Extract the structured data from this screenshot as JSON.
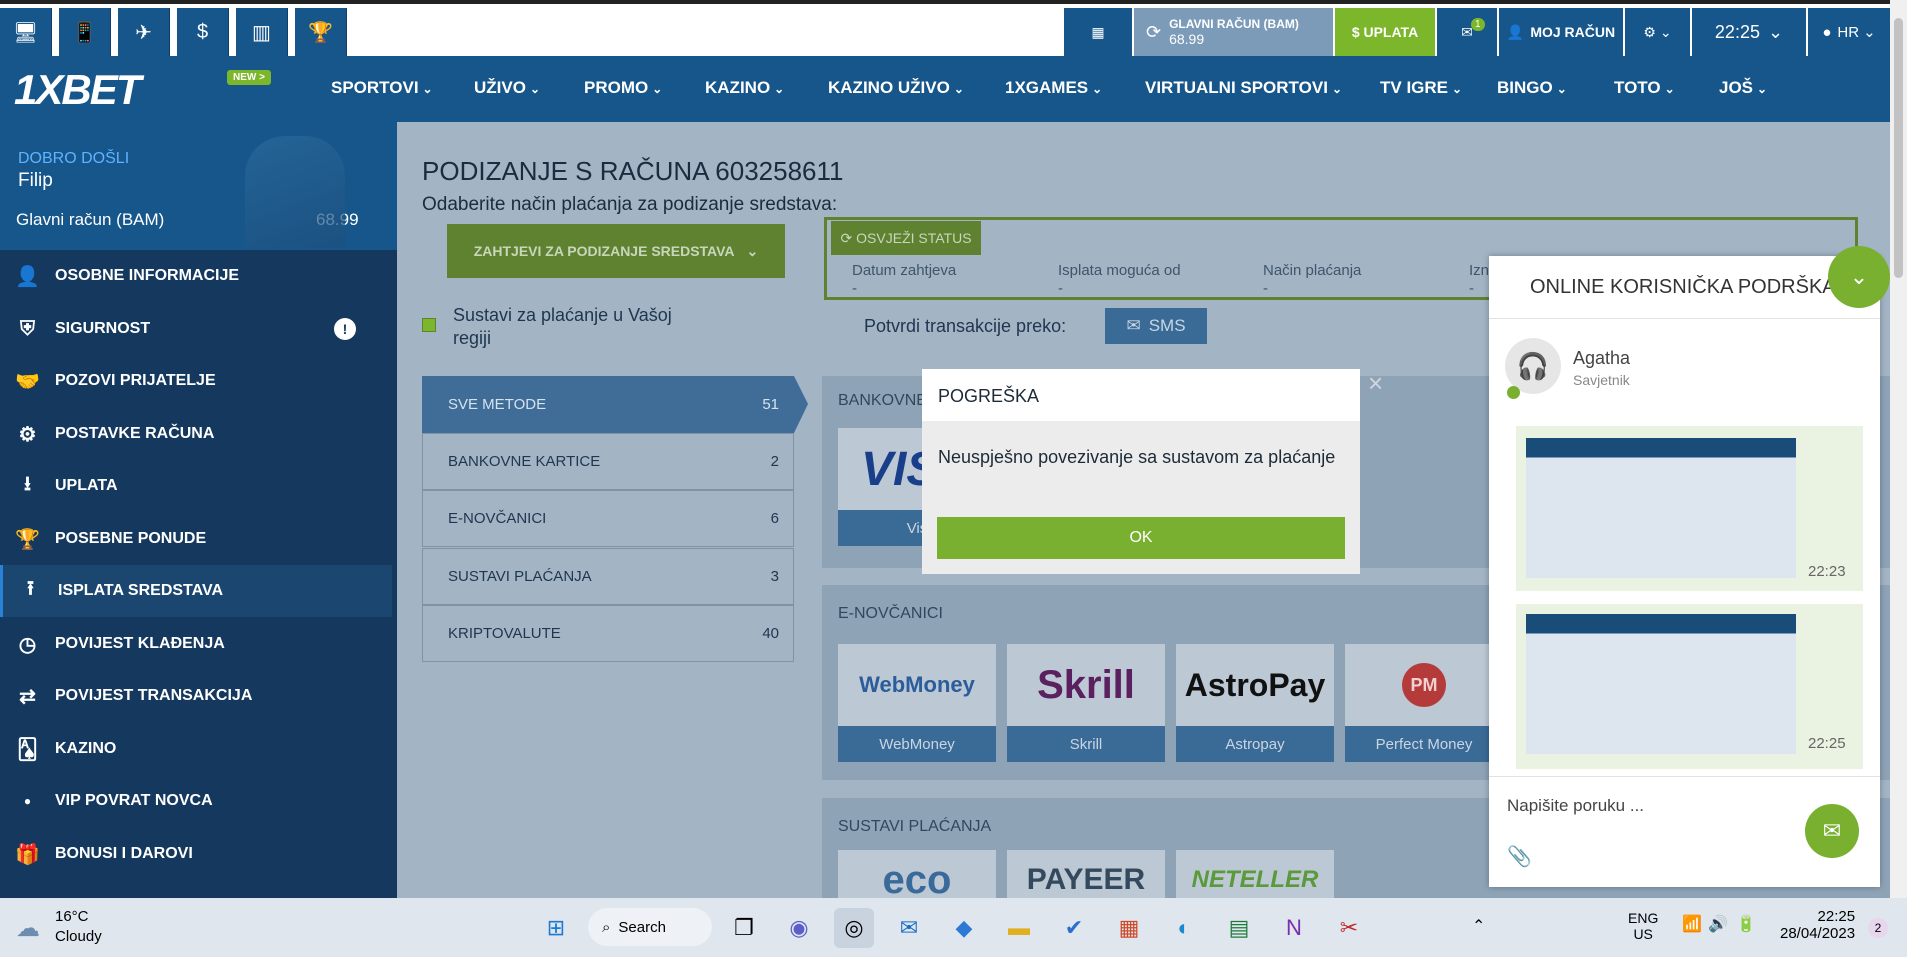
{
  "topbar": {
    "icons": [
      "desktop-icon",
      "mobile-icon",
      "telegram-icon",
      "dollar-icon",
      "stats-icon",
      "trophy-icon"
    ],
    "balance_label": "GLAVNI RAČUN (BAM)",
    "balance_value": "68.99",
    "deposit_label": "$ UPLATA",
    "messages_count": "1",
    "account_label": "MOJ RAČUN",
    "time": "22:25",
    "lang": "HR"
  },
  "nav": {
    "logo": "1XBET",
    "new_badge": "NEW >",
    "items": [
      "SPORTOVI",
      "UŽIVO",
      "PROMO",
      "KAZINO",
      "KAZINO UŽIVO",
      "1XGAMES",
      "VIRTUALNI SPORTOVI",
      "TV IGRE",
      "BINGO",
      "TOTO",
      "JOŠ"
    ]
  },
  "sidebar": {
    "welcome": "DOBRO DOŠLI",
    "user": "Filip",
    "account_label": "Glavni račun (BAM)",
    "account_value": "68.99",
    "items": [
      {
        "label": "OSOBNE INFORMACIJE",
        "icon": "user-add-icon"
      },
      {
        "label": "SIGURNOST",
        "icon": "shield-icon"
      },
      {
        "label": "POZOVI PRIJATELJE",
        "icon": "handshake-icon"
      },
      {
        "label": "POSTAVKE RAČUNA",
        "icon": "gears-icon"
      },
      {
        "label": "UPLATA",
        "icon": "download-icon"
      },
      {
        "label": "POSEBNE PONUDE",
        "icon": "trophy-icon"
      },
      {
        "label": "ISPLATA SREDSTAVA",
        "icon": "upload-icon"
      },
      {
        "label": "POVIJEST KLAĐENJA",
        "icon": "history-icon"
      },
      {
        "label": "POVIJEST TRANSAKCIJA",
        "icon": "transfer-icon"
      },
      {
        "label": "KAZINO",
        "icon": "cards-icon"
      },
      {
        "label": "VIP POVRAT NOVCA",
        "icon": "dot-icon"
      },
      {
        "label": "BONUSI I DAROVI",
        "icon": "gift-icon"
      }
    ]
  },
  "main": {
    "title": "PODIZANJE S RAČUNA 603258611",
    "subtitle": "Odaberite način plaćanja za podizanje sredstava:",
    "requests_button": "ZAHTJEVI ZA PODIZANJE SREDSTAVA",
    "refresh_status": "OSVJEŽI STATUS",
    "status_cols": [
      "Datum zahtjeva",
      "Isplata moguća od",
      "Način plaćanja",
      "Izn"
    ],
    "status_vals": [
      "-",
      "-",
      "-",
      "-"
    ],
    "region_checkbox": "Sustavi za plaćanje u Vašoj regiji",
    "confirm_label": "Potvrdi transakcije preko:",
    "sms_label": "SMS",
    "methods": [
      {
        "label": "SVE METODE",
        "count": "51"
      },
      {
        "label": "BANKOVNE KARTICE",
        "count": "2"
      },
      {
        "label": "E-NOVČANICI",
        "count": "6"
      },
      {
        "label": "SUSTAVI PLAĆANJA",
        "count": "3"
      },
      {
        "label": "KRIPTOVALUTE",
        "count": "40"
      }
    ],
    "bank_section": "BANKOVNE",
    "visa_caption": "Vis",
    "ewallet_section": "E-NOVČANICI",
    "ewallets": [
      {
        "logo": "WebMoney",
        "caption": "WebMoney"
      },
      {
        "logo": "Skrill",
        "caption": "Skrill"
      },
      {
        "logo": "AstroPay",
        "caption": "Astropay"
      },
      {
        "logo": "PM",
        "caption": "Perfect Money"
      }
    ],
    "payment_section": "SUSTAVI PLAĆANJA",
    "payment_logos": [
      "eco",
      "PAYEER",
      "NETELLER"
    ]
  },
  "modal": {
    "title": "POGREŠKA",
    "message": "Neuspješno povezivanje sa sustavom za plaćanje",
    "ok": "OK"
  },
  "chat": {
    "title": "ONLINE KORISNIČKA PODRŠKA",
    "agent_name": "Agatha",
    "agent_role": "Savjetnik",
    "msg_times": [
      "22:23",
      "22:25"
    ],
    "input_placeholder": "Napišite poruku ..."
  },
  "taskbar": {
    "weather_temp": "16°C",
    "weather_desc": "Cloudy",
    "search": "Search",
    "lang1": "ENG",
    "lang2": "US",
    "time": "22:25",
    "date": "28/04/2023",
    "notif": "2"
  }
}
